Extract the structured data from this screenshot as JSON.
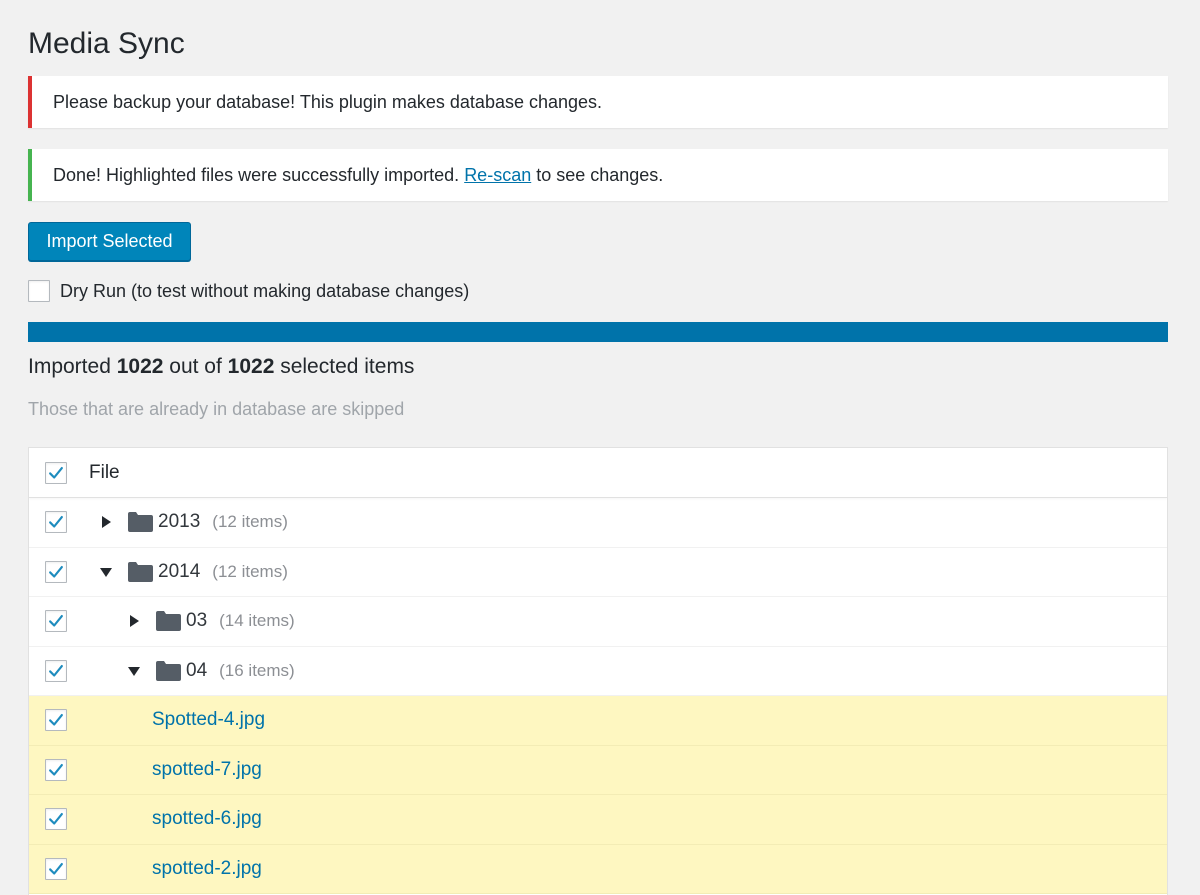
{
  "page": {
    "title": "Media Sync"
  },
  "notices": {
    "error": {
      "text": "Please backup your database! This plugin makes database changes."
    },
    "success": {
      "text_before": "Done! Highlighted files were successfully imported. ",
      "link_text": "Re-scan",
      "text_after": " to see changes."
    }
  },
  "actions": {
    "import_label": "Import Selected"
  },
  "dry_run": {
    "label": "Dry Run (to test without making database changes)",
    "checked": false
  },
  "progress": {
    "fraction": 1.0,
    "prefix": "Imported ",
    "imported": "1022",
    "middle": " out of ",
    "total": "1022",
    "suffix": " selected items",
    "hint": "Those that are already in database are skipped"
  },
  "table": {
    "header": {
      "label": "File",
      "checked": true
    },
    "rows": [
      {
        "type": "folder",
        "level": 0,
        "expanded": false,
        "name": "2013",
        "count": "(12 items)",
        "checked": true
      },
      {
        "type": "folder",
        "level": 0,
        "expanded": true,
        "name": "2014",
        "count": "(12 items)",
        "checked": true
      },
      {
        "type": "folder",
        "level": 1,
        "expanded": false,
        "name": "03",
        "count": "(14 items)",
        "checked": true
      },
      {
        "type": "folder",
        "level": 1,
        "expanded": true,
        "name": "04",
        "count": "(16 items)",
        "checked": true
      },
      {
        "type": "file",
        "level": 2,
        "name": "Spotted-4.jpg",
        "checked": true,
        "highlight": true
      },
      {
        "type": "file",
        "level": 2,
        "name": "spotted-7.jpg",
        "checked": true,
        "highlight": true
      },
      {
        "type": "file",
        "level": 2,
        "name": "spotted-6.jpg",
        "checked": true,
        "highlight": true
      },
      {
        "type": "file",
        "level": 2,
        "name": "spotted-2.jpg",
        "checked": true,
        "highlight": true
      }
    ]
  },
  "colors": {
    "accent": "#0073aa",
    "error": "#dc3232",
    "success": "#46b450",
    "highlight": "#fef7c1",
    "check": "#1e8cbe"
  }
}
